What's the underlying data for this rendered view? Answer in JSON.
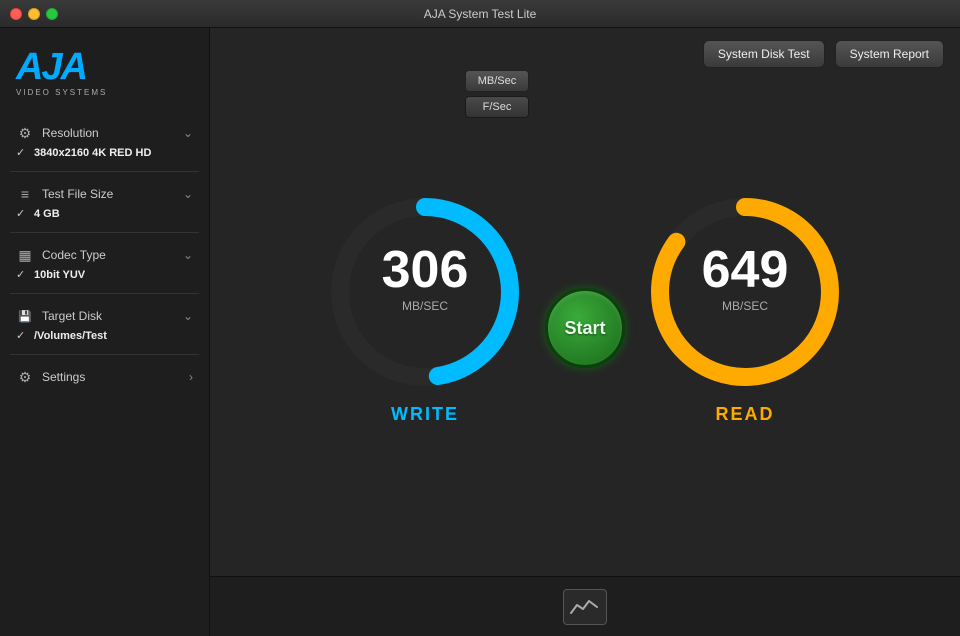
{
  "window": {
    "title": "AJA System Test Lite",
    "buttons": {
      "close": "●",
      "minimize": "●",
      "maximize": "●"
    }
  },
  "logo": {
    "brand": "AJA",
    "subtitle": "VIDEO SYSTEMS"
  },
  "sidebar": {
    "items": [
      {
        "id": "resolution",
        "icon": "⚙",
        "label": "Resolution",
        "value": "3840x2160 4K RED HD",
        "has_check": true
      },
      {
        "id": "test-file-size",
        "icon": "≡",
        "label": "Test File Size",
        "value": "4 GB",
        "has_check": true
      },
      {
        "id": "codec-type",
        "icon": "▦",
        "label": "Codec Type",
        "value": "10bit YUV",
        "has_check": true
      },
      {
        "id": "target-disk",
        "icon": "⬟",
        "label": "Target Disk",
        "value": "/Volumes/Test",
        "has_check": true
      },
      {
        "id": "settings",
        "icon": "⚙",
        "label": "Settings",
        "value": "",
        "has_check": false
      }
    ]
  },
  "toolbar": {
    "system_disk_test_label": "System Disk Test",
    "system_report_label": "System Report"
  },
  "units": {
    "mb_sec": "MB/Sec",
    "f_sec": "F/Sec"
  },
  "write_gauge": {
    "value": "306",
    "unit": "MB/SEC",
    "label": "WRITE",
    "color": "#00bbff",
    "ring_color": "#00bbff",
    "percent": 47
  },
  "read_gauge": {
    "value": "649",
    "unit": "MB/SEC",
    "label": "READ",
    "color": "#ffaa00",
    "ring_color": "#ffaa00",
    "percent": 85
  },
  "start_button": {
    "label": "Start"
  }
}
